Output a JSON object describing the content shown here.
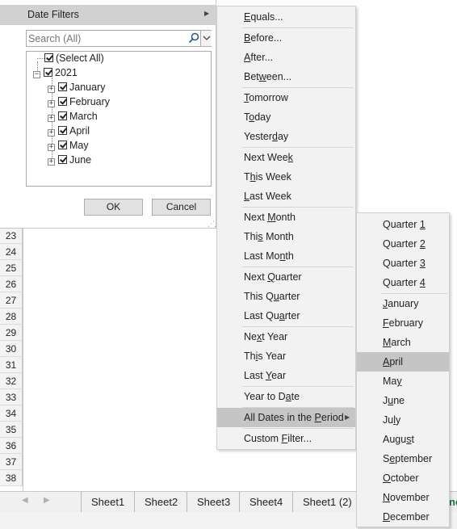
{
  "filter_panel": {
    "date_filters_label": "Date Filters",
    "search_placeholder": "Search (All)",
    "tree": {
      "select_all": "(Select All)",
      "year": "2021",
      "months": [
        "January",
        "February",
        "March",
        "April",
        "May",
        "June"
      ]
    },
    "ok_label": "OK",
    "cancel_label": "Cancel"
  },
  "date_filters_menu": {
    "items": [
      {
        "pre": "",
        "u": "E",
        "post": "quals..."
      },
      {
        "pre": "",
        "u": "B",
        "post": "efore..."
      },
      {
        "pre": "",
        "u": "A",
        "post": "fter..."
      },
      {
        "pre": "Bet",
        "u": "w",
        "post": "een..."
      },
      {
        "pre": "",
        "u": "T",
        "post": "omorrow"
      },
      {
        "pre": "T",
        "u": "o",
        "post": "day"
      },
      {
        "pre": "Yester",
        "u": "d",
        "post": "ay"
      },
      {
        "pre": "Next Wee",
        "u": "k",
        "post": ""
      },
      {
        "pre": "T",
        "u": "h",
        "post": "is Week"
      },
      {
        "pre": "",
        "u": "L",
        "post": "ast Week"
      },
      {
        "pre": "Next ",
        "u": "M",
        "post": "onth"
      },
      {
        "pre": "Thi",
        "u": "s",
        "post": " Month"
      },
      {
        "pre": "Last Mo",
        "u": "n",
        "post": "th"
      },
      {
        "pre": "Next ",
        "u": "Q",
        "post": "uarter"
      },
      {
        "pre": "This Q",
        "u": "u",
        "post": "arter"
      },
      {
        "pre": "Last Qu",
        "u": "a",
        "post": "rter"
      },
      {
        "pre": "Ne",
        "u": "x",
        "post": "t Year"
      },
      {
        "pre": "Th",
        "u": "i",
        "post": "s Year"
      },
      {
        "pre": "Last ",
        "u": "Y",
        "post": "ear"
      },
      {
        "pre": "Year to D",
        "u": "a",
        "post": "te"
      },
      {
        "pre": "All Dates in the ",
        "u": "P",
        "post": "eriod"
      },
      {
        "pre": "Custom ",
        "u": "F",
        "post": "ilter..."
      }
    ]
  },
  "period_menu": {
    "highlighted": "April",
    "items": [
      {
        "pre": "Quarter ",
        "u": "1",
        "post": ""
      },
      {
        "pre": "Quarter ",
        "u": "2",
        "post": ""
      },
      {
        "pre": "Quarter ",
        "u": "3",
        "post": ""
      },
      {
        "pre": "Quarter ",
        "u": "4",
        "post": ""
      },
      {
        "pre": "",
        "u": "J",
        "post": "anuary"
      },
      {
        "pre": "",
        "u": "F",
        "post": "ebruary"
      },
      {
        "pre": "",
        "u": "M",
        "post": "arch"
      },
      {
        "pre": "",
        "u": "A",
        "post": "pril"
      },
      {
        "pre": "Ma",
        "u": "y",
        "post": ""
      },
      {
        "pre": "J",
        "u": "u",
        "post": "ne"
      },
      {
        "pre": "Ju",
        "u": "l",
        "post": "y"
      },
      {
        "pre": "Augu",
        "u": "s",
        "post": "t"
      },
      {
        "pre": "S",
        "u": "e",
        "post": "ptember"
      },
      {
        "pre": "",
        "u": "O",
        "post": "ctober"
      },
      {
        "pre": "",
        "u": "N",
        "post": "ovember"
      },
      {
        "pre": "",
        "u": "D",
        "post": "ecember"
      }
    ]
  },
  "row_numbers": [
    "23",
    "24",
    "25",
    "26",
    "27",
    "28",
    "29",
    "30",
    "31",
    "32",
    "33",
    "34",
    "35",
    "36",
    "37",
    "38"
  ],
  "sheet_tabs": [
    "Sheet1",
    "Sheet2",
    "Sheet3",
    "Sheet4",
    "Sheet1 (2)"
  ],
  "edge_text": "ne"
}
